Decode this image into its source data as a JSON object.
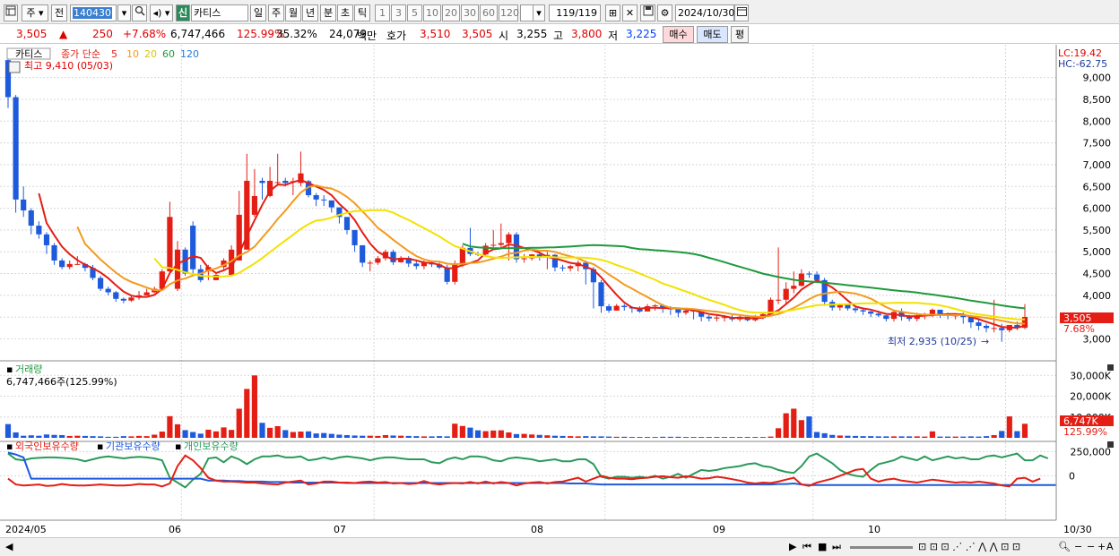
{
  "toolbar": {
    "market_btn": "주",
    "prev_btn": "전",
    "code": "140430",
    "badge": "신",
    "name": "카티스",
    "periods": [
      "일",
      "주",
      "월",
      "년",
      "분",
      "초",
      "틱"
    ],
    "nums": [
      "1",
      "3",
      "5",
      "10",
      "20",
      "30",
      "60",
      "120"
    ],
    "page": "119",
    "page_total": "/119",
    "date": "2024/10/30"
  },
  "quote": {
    "price": "3,505",
    "change": "250",
    "pct": "+7.68%",
    "volume": "6,747,466",
    "vol_pct": "125.99%",
    "turnover": "35.32%",
    "amount": "24,079",
    "amount_unit": "백만",
    "hoga_label": "호가",
    "ask": "3,510",
    "bid": "3,505",
    "open_label": "시",
    "open": "3,255",
    "high_label": "고",
    "high": "3,800",
    "low_label": "저",
    "low": "3,225",
    "buy": "매수",
    "sell": "매도",
    "avg": "평"
  },
  "price_panel": {
    "name": "카티스",
    "ma_title": "종가 단순",
    "ma_labels": [
      "5",
      "10",
      "20",
      "60",
      "120"
    ],
    "ma_colors": [
      "#e41e14",
      "#f39a1e",
      "#f2e200",
      "#1e9a3c",
      "#1e7adc"
    ],
    "high_note": "최고 9,410 (05/03)",
    "low_note": "최저 2,935 (10/25)",
    "lc": "LC:19.42",
    "hc": "HC:-62.75",
    "price_tag": "3,505",
    "pct_tag": "7.68%"
  },
  "volume_panel": {
    "title": "거래량",
    "value": "6,747,466주(125.99%)",
    "tag": "6,747K",
    "pct_tag": "125.99%",
    "ticks": [
      "30,000K",
      "20,000K",
      "10,000K"
    ]
  },
  "holding_panel": {
    "labels": [
      "외국인보유수량",
      "기관보유수량",
      "개인보유수량"
    ],
    "colors": [
      "#e41e14",
      "#1e5adc",
      "#2a9a5a"
    ],
    "ticks": [
      "250,000",
      "0"
    ]
  },
  "x_labels": [
    "2024/05",
    "06",
    "07",
    "08",
    "09",
    "10"
  ],
  "end_label": "10/30",
  "chart_data": {
    "type": "candlestick",
    "price_ticks": [
      3000,
      3500,
      4000,
      4500,
      5000,
      5500,
      6000,
      6500,
      7000,
      7500,
      8000,
      8500,
      9000
    ],
    "ylim": [
      2600,
      9650
    ],
    "volume_ylim": [
      0,
      34000
    ],
    "holding_ylim": [
      -450000,
      300000
    ],
    "month_starts": [
      0,
      23,
      48,
      78,
      105,
      130
    ],
    "open": [
      9400,
      8550,
      6200,
      5950,
      5600,
      5400,
      5150,
      4800,
      4650,
      4720,
      4720,
      4630,
      4400,
      4150,
      4070,
      3920,
      3880,
      3950,
      4000,
      4070,
      4150,
      4550,
      4150,
      5050,
      5600,
      4600,
      4550,
      4350,
      4650,
      4470,
      4800,
      5050,
      5850,
      6630,
      6280,
      6580,
      6630,
      6600,
      6580,
      6620,
      6300,
      6200,
      6180,
      6020,
      5800,
      5500,
      5150,
      4750,
      4750,
      4850,
      5000,
      4760,
      4860,
      4730,
      4670,
      4750,
      4710,
      4640,
      4310,
      4730,
      5090,
      4950,
      4940,
      5140,
      5160,
      5200,
      5400,
      4830,
      4850,
      4940,
      4870,
      4930,
      4640,
      4620,
      4670,
      4750,
      4600,
      4300,
      3750,
      3650,
      3760,
      3730,
      3700,
      3630,
      3750,
      3770,
      3700,
      3690,
      3600,
      3650,
      3630,
      3510,
      3470,
      3490,
      3500,
      3450,
      3510,
      3430,
      3480,
      3570,
      3900,
      3900,
      4150,
      4220,
      4500,
      4480,
      4350,
      3850,
      3720,
      3790,
      3700,
      3660,
      3630,
      3580,
      3540,
      3460,
      3620,
      3510,
      3460,
      3540,
      3550,
      3670,
      3560,
      3540,
      3540,
      3500,
      3380,
      3300,
      3250,
      3250,
      3200,
      3320,
      3255
    ],
    "close": [
      8550,
      6200,
      5950,
      5600,
      5400,
      5150,
      4800,
      4650,
      4720,
      4720,
      4630,
      4400,
      4150,
      4070,
      3920,
      3880,
      3950,
      4000,
      4070,
      4150,
      4550,
      5800,
      5050,
      4500,
      4600,
      4350,
      4650,
      4470,
      4800,
      5050,
      5850,
      6630,
      6280,
      6580,
      6630,
      6600,
      6580,
      6620,
      6800,
      6300,
      6200,
      6180,
      6020,
      5800,
      5500,
      5150,
      4750,
      4750,
      4850,
      5000,
      4760,
      4860,
      4730,
      4670,
      4750,
      4710,
      4640,
      4310,
      4730,
      5090,
      4950,
      4940,
      5140,
      5160,
      5200,
      5400,
      4830,
      4850,
      4940,
      4870,
      4930,
      4640,
      4620,
      4670,
      4750,
      4600,
      4300,
      3750,
      3650,
      3760,
      3730,
      3700,
      3630,
      3750,
      3770,
      3700,
      3690,
      3600,
      3650,
      3630,
      3510,
      3470,
      3490,
      3500,
      3450,
      3510,
      3430,
      3480,
      3570,
      3900,
      3900,
      4150,
      4220,
      4500,
      4480,
      4350,
      3850,
      3720,
      3790,
      3700,
      3660,
      3630,
      3580,
      3540,
      3460,
      3620,
      3510,
      3460,
      3540,
      3550,
      3670,
      3560,
      3540,
      3540,
      3500,
      3380,
      3300,
      3250,
      3250,
      3200,
      3320,
      3255,
      3505
    ],
    "high": [
      9410,
      8600,
      6500,
      6000,
      5700,
      5450,
      5200,
      4850,
      4800,
      4900,
      4750,
      4700,
      4450,
      4200,
      4100,
      3950,
      4000,
      4100,
      4150,
      4200,
      4600,
      6150,
      5250,
      5100,
      5700,
      4700,
      4700,
      4500,
      4850,
      5150,
      6400,
      7250,
      6900,
      6700,
      6950,
      7250,
      6700,
      6700,
      7300,
      6650,
      6350,
      6300,
      6100,
      5900,
      5550,
      5200,
      4950,
      4800,
      4900,
      5050,
      5050,
      4900,
      4900,
      4800,
      4800,
      4800,
      4750,
      4700,
      4800,
      5150,
      5550,
      5000,
      5200,
      5500,
      5650,
      5450,
      5450,
      4950,
      4950,
      5000,
      5000,
      4950,
      4700,
      4700,
      4800,
      4800,
      4650,
      4350,
      3800,
      3800,
      3800,
      3750,
      3750,
      3800,
      3800,
      3800,
      3750,
      3650,
      3700,
      3700,
      3600,
      3550,
      3550,
      3550,
      3550,
      3550,
      3550,
      3550,
      3600,
      3950,
      5100,
      4300,
      4550,
      4600,
      4550,
      4550,
      4400,
      3900,
      3750,
      3800,
      3750,
      3700,
      3650,
      3650,
      3550,
      3650,
      3700,
      3550,
      3600,
      3600,
      3700,
      3650,
      3600,
      3550,
      3600,
      3550,
      3450,
      3350,
      3900,
      3350,
      3300,
      3400,
      3800
    ],
    "low": [
      8300,
      5900,
      5800,
      5400,
      5300,
      4950,
      4700,
      4600,
      4600,
      4700,
      4550,
      4350,
      4100,
      4000,
      3850,
      3820,
      3850,
      3900,
      4000,
      4050,
      4100,
      4500,
      4100,
      4450,
      4500,
      4300,
      4350,
      4350,
      4600,
      4800,
      5000,
      5800,
      5800,
      6200,
      6250,
      6550,
      6500,
      6300,
      6500,
      6250,
      6050,
      6050,
      5900,
      5650,
      5400,
      5000,
      4650,
      4550,
      4700,
      4800,
      4700,
      4750,
      4650,
      4600,
      4600,
      4650,
      4600,
      4250,
      4250,
      4650,
      4900,
      4900,
      4900,
      5100,
      5100,
      4800,
      4750,
      4750,
      4800,
      4800,
      4600,
      4550,
      4550,
      4550,
      4550,
      4250,
      3700,
      3600,
      3600,
      3650,
      3650,
      3600,
      3600,
      3650,
      3650,
      3600,
      3550,
      3500,
      3550,
      3450,
      3400,
      3400,
      3400,
      3400,
      3400,
      3400,
      3400,
      3400,
      3450,
      3550,
      3800,
      3800,
      4050,
      4200,
      4400,
      4350,
      3800,
      3650,
      3650,
      3650,
      3600,
      3550,
      3500,
      3500,
      3400,
      3400,
      3420,
      3400,
      3400,
      3450,
      3500,
      3480,
      3450,
      3450,
      3350,
      3250,
      3200,
      3150,
      3150,
      2935,
      3150,
      3200,
      3225
    ],
    "volume": [
      6600,
      2600,
      1000,
      1200,
      1000,
      1600,
      1400,
      1300,
      900,
      1000,
      900,
      800,
      700,
      500,
      500,
      800,
      700,
      900,
      800,
      1500,
      3000,
      10400,
      6500,
      3700,
      2800,
      2000,
      3900,
      3100,
      5000,
      3800,
      14000,
      23500,
      30000,
      7200,
      4800,
      5600,
      3700,
      2800,
      3000,
      3100,
      2100,
      2300,
      1900,
      1500,
      1300,
      1100,
      1000,
      1000,
      900,
      1300,
      1100,
      1000,
      900,
      800,
      700,
      700,
      800,
      700,
      6800,
      5700,
      4900,
      3600,
      3200,
      3500,
      3600,
      2600,
      1800,
      1900,
      1600,
      1400,
      1200,
      1000,
      900,
      800,
      700,
      800,
      700,
      700,
      600,
      500,
      500,
      400,
      400,
      400,
      400,
      500,
      500,
      500,
      400,
      400,
      400,
      400,
      400,
      400,
      400,
      400,
      400,
      400,
      400,
      600,
      4600,
      11800,
      14000,
      8500,
      10300,
      2800,
      2200,
      1400,
      1100,
      1000,
      900,
      800,
      800,
      700,
      700,
      700,
      700,
      700,
      700,
      600,
      3100,
      600,
      600,
      600,
      600,
      700,
      600,
      800,
      1300,
      3300,
      10300,
      3200,
      6747
    ],
    "foreign": [
      -30000,
      -90000,
      -100000,
      -95000,
      -90000,
      -105000,
      -100000,
      -85000,
      -95000,
      -100000,
      -100000,
      -95000,
      -90000,
      -95000,
      -100000,
      -100000,
      -95000,
      -85000,
      -90000,
      -90000,
      -110000,
      -80000,
      100000,
      210000,
      160000,
      80000,
      -20000,
      -50000,
      -60000,
      -60000,
      -65000,
      -70000,
      -70000,
      -80000,
      -85000,
      -90000,
      -70000,
      -60000,
      -50000,
      -90000,
      -80000,
      -60000,
      -60000,
      -70000,
      -70000,
      -75000,
      -65000,
      -60000,
      -70000,
      -65000,
      -80000,
      -75000,
      -85000,
      -80000,
      -55000,
      -80000,
      -90000,
      -80000,
      -75000,
      -80000,
      -65000,
      -80000,
      -60000,
      -80000,
      -65000,
      -75000,
      -100000,
      -80000,
      -70000,
      -65000,
      -80000,
      -65000,
      -60000,
      -40000,
      -20000,
      -60000,
      -30000,
      0,
      -20000,
      -30000,
      -30000,
      -35000,
      -25000,
      -20000,
      -10000,
      -5000,
      -15000,
      -20000,
      -5000,
      -15000,
      -30000,
      -25000,
      -10000,
      -20000,
      -35000,
      -50000,
      -70000,
      -80000,
      -70000,
      -75000,
      -60000,
      -40000,
      -20000,
      -90000,
      -105000,
      -70000,
      -50000,
      -30000,
      0,
      30000,
      60000,
      70000,
      -30000,
      -60000,
      -40000,
      -30000,
      -50000,
      -60000,
      -70000,
      -55000,
      -40000,
      -50000,
      -60000,
      -70000,
      -65000,
      -70000,
      -60000,
      -70000,
      -80000,
      -100000,
      -110000,
      -30000,
      -20000,
      -60000,
      -30000
    ],
    "institution": [
      240000,
      220000,
      190000,
      -30000,
      -30000,
      -30000,
      -30000,
      -30000,
      -30000,
      -30000,
      -30000,
      -30000,
      -30000,
      -30000,
      -30000,
      -30000,
      -30000,
      -30000,
      -30000,
      -30000,
      -30000,
      -30000,
      -30000,
      -30000,
      -30000,
      -30000,
      -50000,
      -50000,
      -50000,
      -55000,
      -55000,
      -60000,
      -60000,
      -60000,
      -65000,
      -65000,
      -65000,
      -70000,
      -70000,
      -70000,
      -70000,
      -70000,
      -70000,
      -70000,
      -75000,
      -75000,
      -75000,
      -75000,
      -75000,
      -75000,
      -75000,
      -75000,
      -75000,
      -75000,
      -75000,
      -75000,
      -75000,
      -75000,
      -75000,
      -75000,
      -75000,
      -75000,
      -75000,
      -75000,
      -75000,
      -75000,
      -75000,
      -75000,
      -75000,
      -75000,
      -75000,
      -75000,
      -75000,
      -80000,
      -80000,
      -80000,
      -85000,
      -90000,
      -90000,
      -90000,
      -90000,
      -90000,
      -90000,
      -90000,
      -90000,
      -90000,
      -90000,
      -90000,
      -90000,
      -90000,
      -90000,
      -90000,
      -90000,
      -90000,
      -90000,
      -90000,
      -90000,
      -90000,
      -90000,
      -90000,
      -85000,
      -85000,
      -80000,
      -90000,
      -95000,
      -95000,
      -95000,
      -95000,
      -95000,
      -95000,
      -95000,
      -95000,
      -95000,
      -95000,
      -95000,
      -95000,
      -95000,
      -95000,
      -95000,
      -95000,
      -95000,
      -95000,
      -95000,
      -95000,
      -95000,
      -95000,
      -95000,
      -95000,
      -95000,
      -95000,
      -95000,
      -95000,
      -95000,
      -95000,
      -95000,
      -95000,
      -95000
    ],
    "individual": [
      230000,
      170000,
      160000,
      180000,
      185000,
      190000,
      190000,
      185000,
      180000,
      170000,
      150000,
      170000,
      190000,
      200000,
      190000,
      180000,
      190000,
      195000,
      190000,
      180000,
      160000,
      -20000,
      -70000,
      -120000,
      -40000,
      20000,
      180000,
      190000,
      140000,
      200000,
      170000,
      120000,
      170000,
      200000,
      200000,
      210000,
      190000,
      190000,
      200000,
      160000,
      170000,
      190000,
      170000,
      190000,
      200000,
      190000,
      180000,
      160000,
      180000,
      190000,
      190000,
      180000,
      170000,
      170000,
      170000,
      140000,
      130000,
      170000,
      190000,
      170000,
      200000,
      200000,
      190000,
      160000,
      150000,
      180000,
      190000,
      180000,
      170000,
      150000,
      160000,
      170000,
      150000,
      150000,
      170000,
      170000,
      120000,
      -10000,
      -30000,
      -10000,
      -10000,
      -20000,
      -10000,
      -20000,
      0,
      -30000,
      -10000,
      20000,
      -20000,
      20000,
      60000,
      50000,
      60000,
      80000,
      90000,
      100000,
      120000,
      130000,
      100000,
      90000,
      60000,
      40000,
      30000,
      100000,
      200000,
      230000,
      180000,
      130000,
      60000,
      20000,
      0,
      -10000,
      60000,
      120000,
      140000,
      160000,
      200000,
      180000,
      160000,
      200000,
      160000,
      180000,
      200000,
      180000,
      190000,
      170000,
      170000,
      200000,
      210000,
      190000,
      210000,
      230000,
      160000,
      160000,
      210000,
      180000
    ]
  }
}
